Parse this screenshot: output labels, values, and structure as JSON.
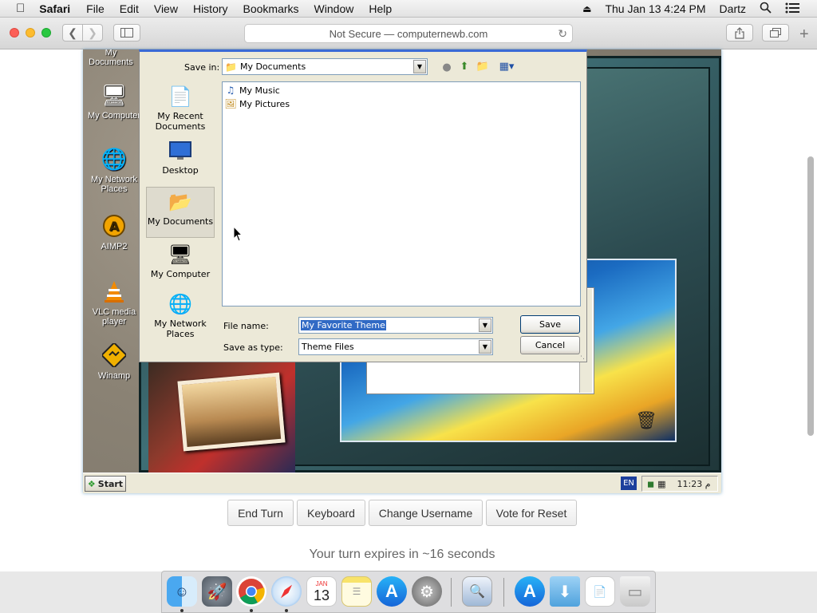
{
  "menubar": {
    "apple": "",
    "app_name": "Safari",
    "items": [
      "File",
      "Edit",
      "View",
      "History",
      "Bookmarks",
      "Window",
      "Help"
    ],
    "clock": "Thu Jan 13  4:24 PM",
    "user": "Dartz"
  },
  "browser": {
    "address": "Not Secure — computernewb.com"
  },
  "desktop": {
    "icons": [
      "My Documents",
      "My Computer",
      "My Network Places",
      "AIMP2",
      "VLC media player",
      "Winamp"
    ]
  },
  "dialog": {
    "save_in_label": "Save in:",
    "save_in_value": "My Documents",
    "places": [
      "My Recent Documents",
      "Desktop",
      "My Documents",
      "My Computer",
      "My Network Places"
    ],
    "files": [
      "My Music",
      "My Pictures"
    ],
    "file_name_label": "File name:",
    "file_name_value": "My Favorite Theme",
    "save_type_label": "Save as type:",
    "save_type_value": "Theme Files",
    "save_button": "Save",
    "cancel_button": "Cancel"
  },
  "taskbar": {
    "start": "Start",
    "lang": "EN",
    "time": "11:23 م"
  },
  "controls": {
    "end_turn": "End Turn",
    "keyboard": "Keyboard",
    "change_username": "Change Username",
    "vote_reset": "Vote for Reset",
    "turn_message": "Your turn expires in ~16 seconds"
  },
  "dock_apps": [
    "finder-icon",
    "launchpad-icon",
    "chrome-icon",
    "safari-icon",
    "calendar-icon",
    "notes-icon",
    "app-store-icon",
    "system-preferences-icon",
    "preview-icon",
    "app-store-download-icon",
    "downloads-folder-icon",
    "document-icon",
    "trash-icon"
  ],
  "calendar_icon": {
    "month": "JAN",
    "day": "13"
  }
}
